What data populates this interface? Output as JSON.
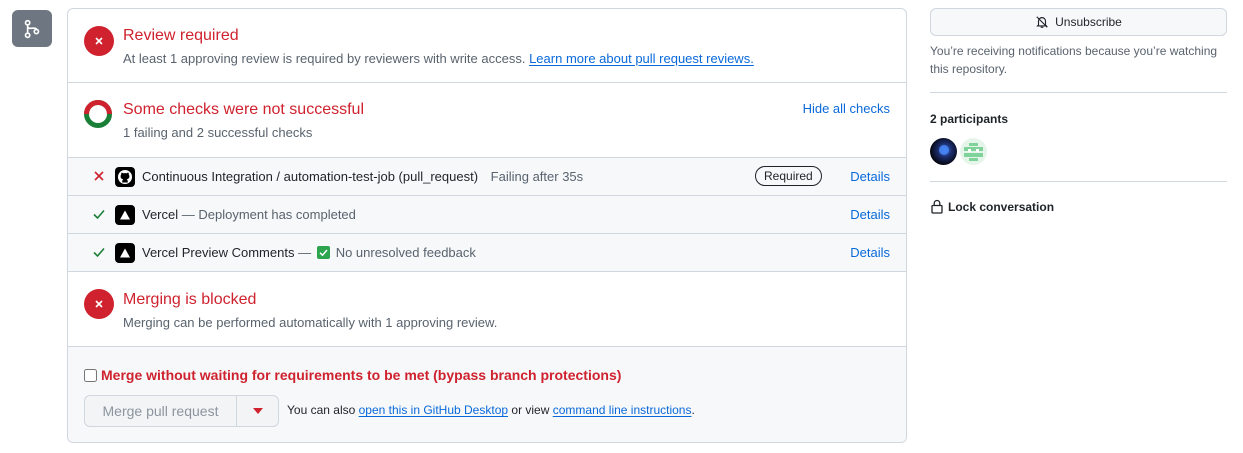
{
  "review": {
    "title": "Review required",
    "description": "At least 1 approving review is required by reviewers with write access.",
    "link": "Learn more about pull request reviews."
  },
  "checks": {
    "title": "Some checks were not successful",
    "summary": "1 failing and 2 successful checks",
    "toggle": "Hide all checks",
    "rows": [
      {
        "status": "failure",
        "name": "Continuous Integration / automation-test-job (pull_request)",
        "desc": "Failing after 35s",
        "badge": "Required",
        "details": "Details",
        "icon": "github-icon"
      },
      {
        "status": "success",
        "name": "Vercel",
        "desc": " — Deployment has completed",
        "details": "Details",
        "icon": "vercel-icon"
      },
      {
        "status": "success",
        "name": "Vercel Preview Comments",
        "desc_prefix": " — ",
        "desc": "No unresolved feedback",
        "details": "Details",
        "icon": "vercel-icon"
      }
    ]
  },
  "blocked": {
    "title": "Merging is blocked",
    "description": "Merging can be performed automatically with 1 approving review."
  },
  "merge": {
    "bypass_label": "Merge without waiting for requirements to be met (bypass branch protections)",
    "button": "Merge pull request",
    "help_prefix": "You can also",
    "desktop_link": "open this in GitHub Desktop",
    "help_mid": "or view",
    "cli_link": "command line instructions",
    "help_suffix": "."
  },
  "sidebar": {
    "unsubscribe": "Unsubscribe",
    "notification_text": "You’re receiving notifications because you’re watching this repository.",
    "participants": "2 participants",
    "lock": "Lock conversation"
  },
  "colors": {
    "danger": "#cf222e",
    "success": "#1a7f37",
    "link": "#0969da",
    "muted": "#59636e"
  }
}
